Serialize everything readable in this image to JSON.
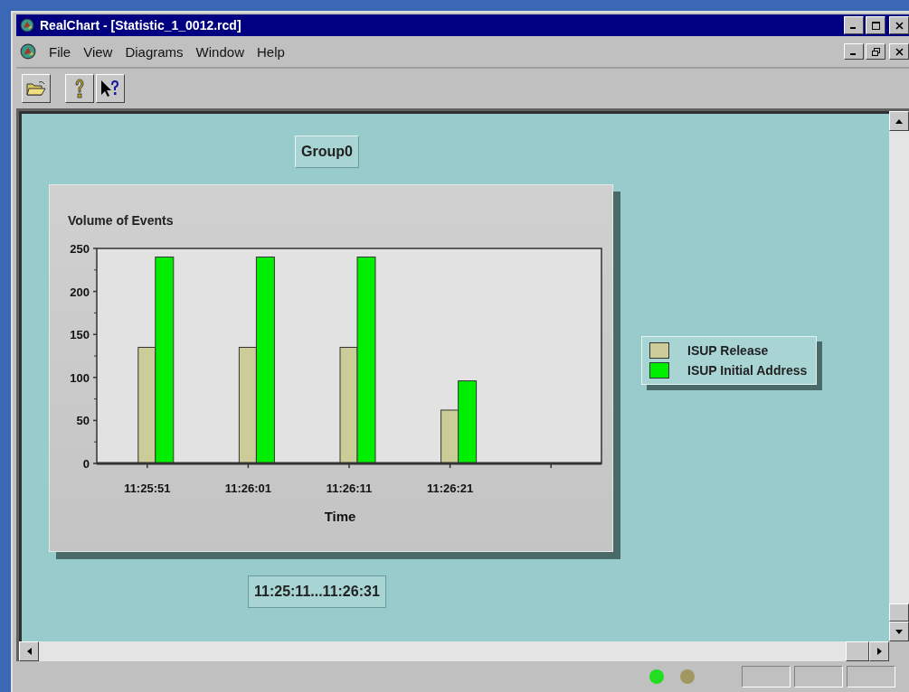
{
  "window": {
    "title": "RealChart - [Statistic_1_0012.rcd]"
  },
  "menu": [
    {
      "label": "File"
    },
    {
      "label": "View"
    },
    {
      "label": "Diagrams"
    },
    {
      "label": "Window"
    },
    {
      "label": "Help"
    }
  ],
  "group_label": "Group0",
  "chart": {
    "chart_data": {
      "type": "bar",
      "title": "Volume of Events",
      "xlabel": "Time",
      "categories": [
        "11:25:51",
        "11:26:01",
        "11:26:11",
        "11:26:21"
      ],
      "ylim": [
        0,
        250
      ],
      "yticks": [
        0,
        50,
        100,
        150,
        200,
        250
      ],
      "series": [
        {
          "name": "ISUP Release",
          "color": "#cccc99",
          "values": [
            135,
            135,
            135,
            62
          ]
        },
        {
          "name": "ISUP Initial Address",
          "color": "#00ee00",
          "values": [
            240,
            240,
            240,
            96
          ]
        }
      ]
    }
  },
  "time_range": "11:25:11...11:26:31",
  "status_bar": {
    "indicators": [
      {
        "color": "#22dd22"
      },
      {
        "color": "#a09860"
      }
    ]
  }
}
